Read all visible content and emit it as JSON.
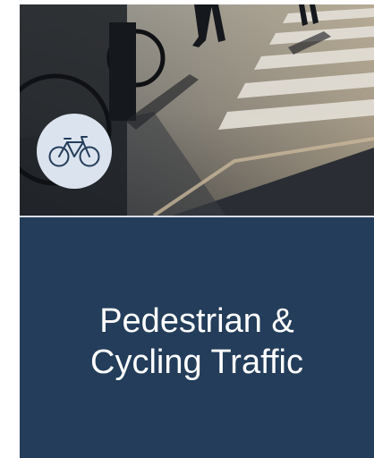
{
  "card": {
    "title_line1": "Pedestrian &",
    "title_line2": "Cycling Traffic",
    "icon": "bicycle-icon",
    "colors": {
      "panel": "#233d5a",
      "badge": "#dbe3ee",
      "icon_stroke": "#233d5a",
      "title_text": "#ffffff"
    }
  }
}
